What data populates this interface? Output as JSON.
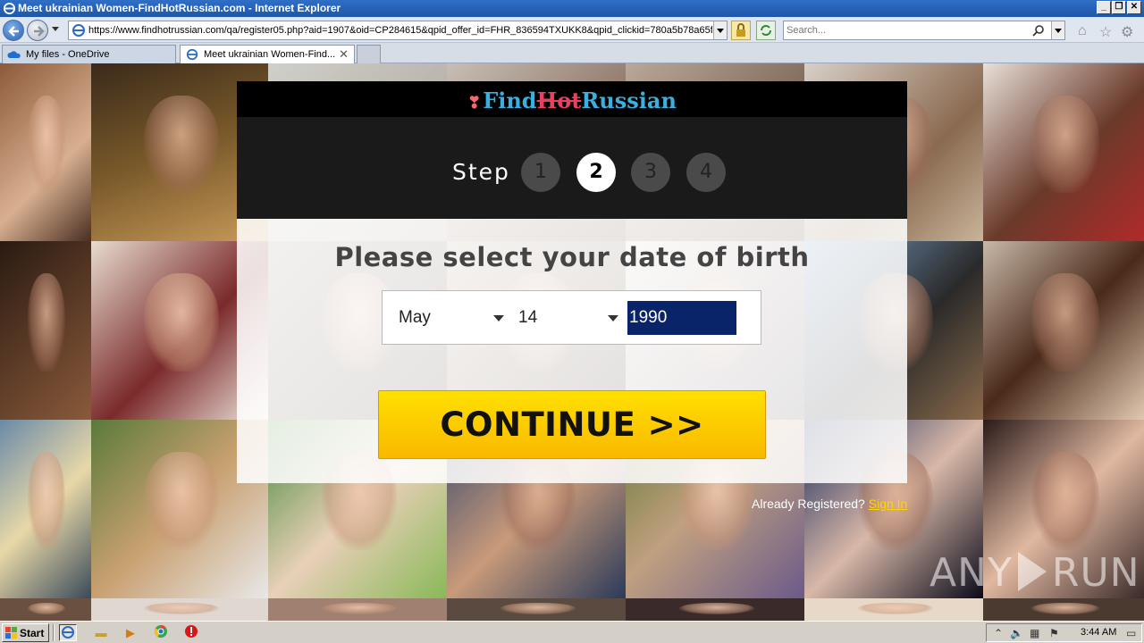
{
  "window": {
    "title": "Meet ukrainian Women-FindHotRussian.com - Internet Explorer",
    "min_label": "_",
    "max_label": "❐",
    "close_label": "✕"
  },
  "addressbar": {
    "url": "https://www.findhotrussian.com/qa/register05.php?aid=1907&oid=CP284615&qpid_offer_id=FHR_836594TXUKK8&qpid_clickid=780a5b78a65f",
    "search_placeholder": "Search..."
  },
  "tabs": [
    {
      "label": "My files - OneDrive"
    },
    {
      "label": "Meet ukrainian Women-Find...",
      "close": "✕"
    }
  ],
  "page": {
    "logo": {
      "find": "Find",
      "hot": "Hot",
      "russian": "Russian"
    },
    "step_label": "Step",
    "steps": [
      "1",
      "2",
      "3",
      "4"
    ],
    "active_step": "2",
    "form_title": "Please select your date of birth",
    "dob": {
      "month": "May",
      "day": "14",
      "year": "1990"
    },
    "continue_label": "CONTINUE >>",
    "already_registered": "Already Registered?",
    "sign_in": "Sign In"
  },
  "watermark": {
    "left": "ANY",
    "right": "RUN"
  },
  "taskbar": {
    "start_label": "Start",
    "clock": "3:44 AM"
  },
  "colors": {
    "accent_yellow": "#ffd400",
    "logo_blue": "#3ab0e0",
    "logo_red": "#e84060",
    "year_highlight": "#0a246a"
  }
}
